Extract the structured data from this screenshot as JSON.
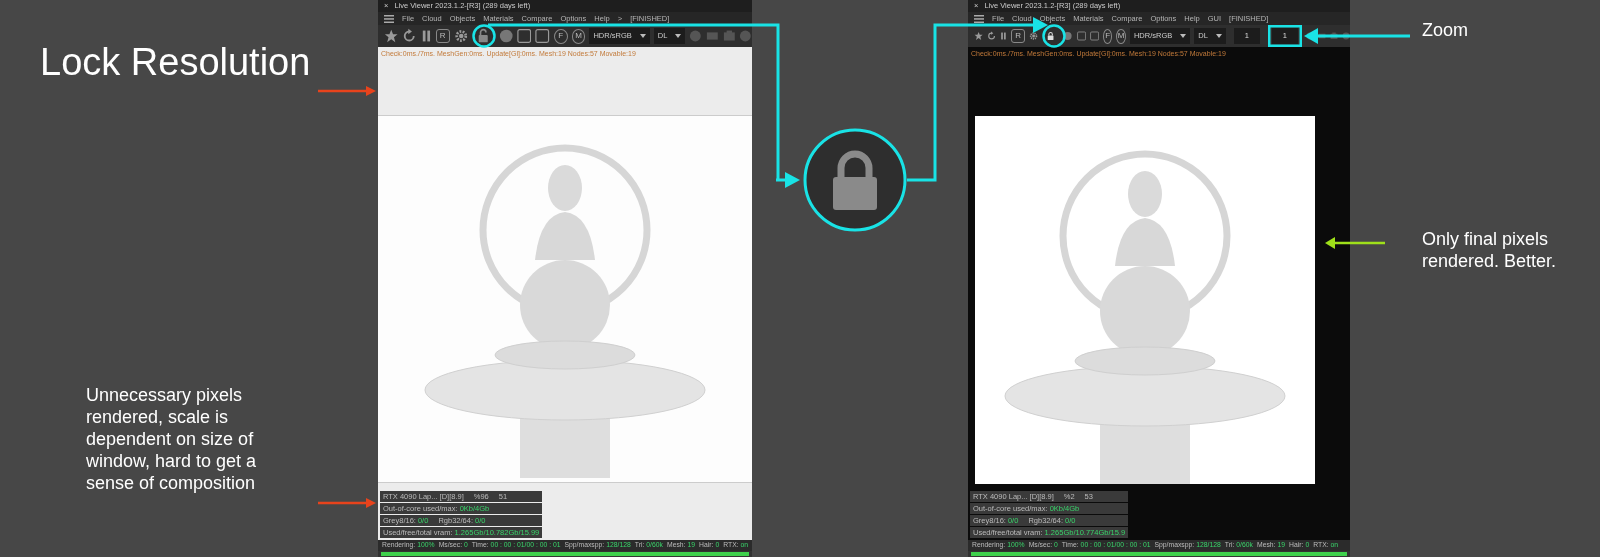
{
  "title": "Lock Resolution",
  "left_notes": [
    {
      "text": "Unnecessary pixels rendered, scale is dependent on size of window, hard to get a sense of composition",
      "color": "#e8431c"
    }
  ],
  "top_pointer": {
    "color": "#e8431c"
  },
  "viewers": [
    {
      "close": "×",
      "title": "Live Viewer 2023.1.2-[R3] (289 days left)",
      "menu": [
        "File",
        "Cloud",
        "Objects",
        "Materials",
        "Compare",
        "Options",
        "Help",
        ">",
        "[FINISHED]"
      ],
      "letters": [
        "R",
        "F",
        "M"
      ],
      "locked": false,
      "dropdowns": [
        "HDR/sRGB",
        "DL"
      ],
      "info": "Check:0ms./7ms. MeshGen:0ms. Update[Gl]:0ms. Mesh:19 Nodes:57 Movable:19",
      "gpu": [
        "RTX 4090 Lap... [D][8.9]",
        "%96",
        "51"
      ],
      "stats": [
        [
          {
            "label": "Out-of-core used/max:",
            "value": "0Kb/4Gb"
          }
        ],
        [
          {
            "label": "Grey8/16:",
            "value": "0/0"
          },
          {
            "label": "Rgb32/64:",
            "value": "0/0"
          }
        ],
        [
          {
            "label": "Used/free/total vram:",
            "value": "1.265Gb/10.782Gb/15.99"
          }
        ]
      ],
      "status": [
        {
          "label": "Rendering:",
          "value": "100%"
        },
        {
          "label": "Ms/sec:",
          "value": "0"
        },
        {
          "label": "Time:",
          "value": "00 : 00 : 01/00 : 00 : 01"
        },
        {
          "label": "Spp/maxspp:",
          "value": "128/128"
        },
        {
          "label": "Tri:",
          "value": "0/60k"
        },
        {
          "label": "Mesh:",
          "value": "19"
        },
        {
          "label": "Hair:",
          "value": "0"
        },
        {
          "label": "RTX:",
          "value": "on"
        }
      ],
      "level": 1
    },
    {
      "close": "×",
      "title": "Live Viewer 2023.1.2-[R3] (289 days left)",
      "menu": [
        "File",
        "Cloud",
        "Objects",
        "Materials",
        "Compare",
        "Options",
        "Help",
        "GUI",
        "[FINISHED]"
      ],
      "letters": [
        "R",
        "F",
        "M"
      ],
      "locked": true,
      "dropdowns": [
        "HDR/sRGB",
        "DL"
      ],
      "fields": [
        "1",
        "1"
      ],
      "info": "Check:0ms./7ms. MeshGen:0ms. Update[Gl]:0ms. Mesh:19 Nodes:57 Movable:19",
      "gpu": [
        "RTX 4090 Lap... [D][8.9]",
        "%2",
        "53"
      ],
      "stats": [
        [
          {
            "label": "Out-of-core used/max:",
            "value": "0Kb/4Gb"
          }
        ],
        [
          {
            "label": "Grey8/16:",
            "value": "0/0"
          },
          {
            "label": "Rgb32/64:",
            "value": "0/0"
          }
        ],
        [
          {
            "label": "Used/free/total vram:",
            "value": "1.265Gb/10.774Gb/15.9"
          }
        ]
      ],
      "status": [
        {
          "label": "Rendering:",
          "value": "100%"
        },
        {
          "label": "Ms/sec:",
          "value": "0"
        },
        {
          "label": "Time:",
          "value": "00 : 00 : 01/00 : 00 : 01"
        },
        {
          "label": "Spp/maxspp:",
          "value": "128/128"
        },
        {
          "label": "Tri:",
          "value": "0/60k"
        },
        {
          "label": "Mesh:",
          "value": "19"
        },
        {
          "label": "Hair:",
          "value": "0"
        },
        {
          "label": "RTX:",
          "value": "on"
        }
      ],
      "level": 1
    }
  ],
  "right_notes": [
    {
      "kind": "zoom",
      "text": "Zoom",
      "color": "#19e3e6"
    },
    {
      "kind": "final",
      "text": "Only final pixels rendered. Better.",
      "color": "#9fe01a"
    }
  ]
}
